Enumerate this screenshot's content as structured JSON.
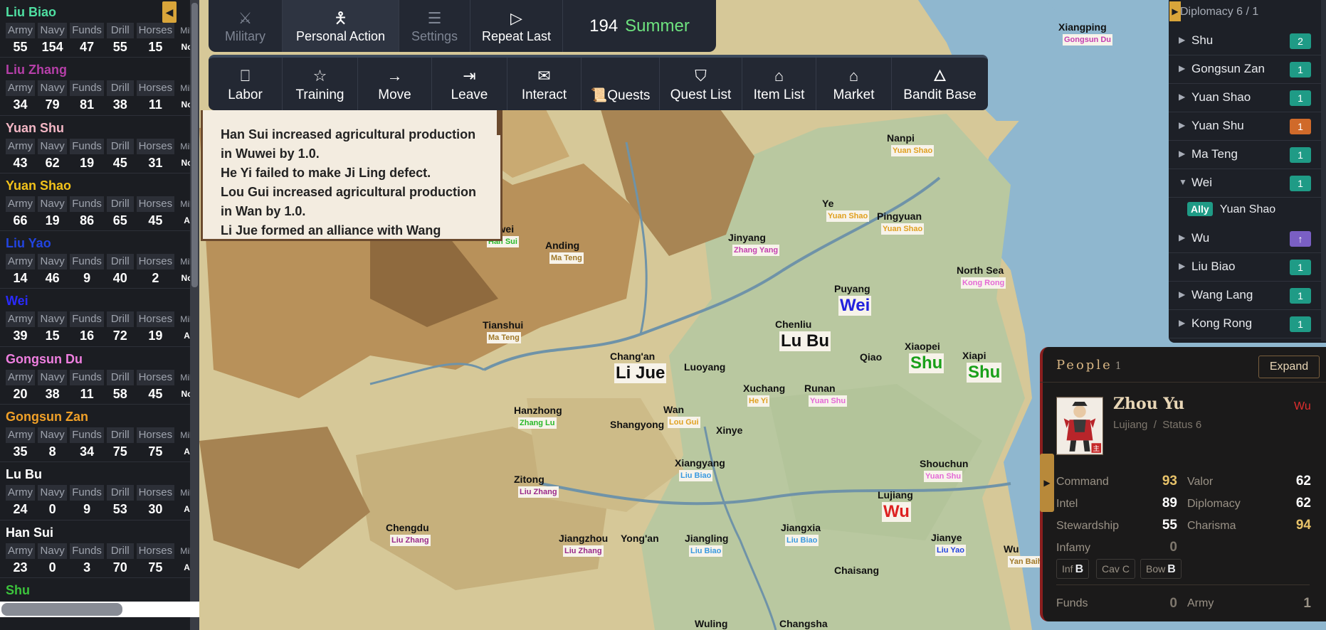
{
  "top_tabs": [
    {
      "label": "Military",
      "icon": "swords-icon"
    },
    {
      "label": "Personal Action",
      "icon": "person-icon"
    },
    {
      "label": "Settings",
      "icon": "sliders-icon"
    },
    {
      "label": "Repeat Last",
      "icon": "play-icon"
    }
  ],
  "date": {
    "year": "194",
    "season": "Summer"
  },
  "actions": [
    {
      "label": "Labor",
      "icon": "briefcase-icon"
    },
    {
      "label": "Training",
      "icon": "star-icon"
    },
    {
      "label": "Move",
      "icon": "arrow-right-icon"
    },
    {
      "label": "Leave",
      "icon": "exit-icon"
    },
    {
      "label": "Interact",
      "icon": "chat-icon"
    },
    {
      "label": "Quests",
      "icon": "scroll-icon"
    },
    {
      "label": "Quest List",
      "icon": "bookmark-icon"
    },
    {
      "label": "Item List",
      "icon": "bag-icon"
    },
    {
      "label": "Market",
      "icon": "shop-bag-icon"
    },
    {
      "label": "Bandit Base",
      "icon": "flame-icon"
    }
  ],
  "log": [
    "Han Sui increased agricultural production",
    "in Wuwei by 1.0.",
    "He Yi failed to make Ji Ling defect.",
    "Lou Gui increased agricultural production",
    "in Wan by 1.0.",
    "Li Jue formed an alliance with Wang"
  ],
  "stat_labels": {
    "army": "Army",
    "navy": "Navy",
    "funds": "Funds",
    "drill": "Drill",
    "horses": "Horses",
    "mil": "Mil."
  },
  "factions": [
    {
      "name": "Liu Biao",
      "color": "#4fe0a2",
      "army": "55",
      "navy": "154",
      "funds": "47",
      "drill": "55",
      "horses": "15",
      "mil": "No"
    },
    {
      "name": "Liu Zhang",
      "color": "#b53fa8",
      "army": "34",
      "navy": "79",
      "funds": "81",
      "drill": "38",
      "horses": "11",
      "mil": "No"
    },
    {
      "name": "Yuan Shu",
      "color": "#f4b7c5",
      "army": "43",
      "navy": "62",
      "funds": "19",
      "drill": "45",
      "horses": "31",
      "mil": "No"
    },
    {
      "name": "Yuan Shao",
      "color": "#f2c21a",
      "army": "66",
      "navy": "19",
      "funds": "86",
      "drill": "65",
      "horses": "45",
      "mil": "A"
    },
    {
      "name": "Liu Yao",
      "color": "#2244e0",
      "army": "14",
      "navy": "46",
      "funds": "9",
      "drill": "40",
      "horses": "2",
      "mil": "No"
    },
    {
      "name": "Wei",
      "color": "#2a2aff",
      "army": "39",
      "navy": "15",
      "funds": "16",
      "drill": "72",
      "horses": "19",
      "mil": "A"
    },
    {
      "name": "Gongsun Du",
      "color": "#ef7fe0",
      "army": "20",
      "navy": "38",
      "funds": "11",
      "drill": "58",
      "horses": "45",
      "mil": "No"
    },
    {
      "name": "Gongsun Zan",
      "color": "#f0a028",
      "army": "35",
      "navy": "8",
      "funds": "34",
      "drill": "75",
      "horses": "75",
      "mil": "A"
    },
    {
      "name": "Lu Bu",
      "color": "#ffffff",
      "army": "24",
      "navy": "0",
      "funds": "9",
      "drill": "53",
      "horses": "30",
      "mil": "A"
    },
    {
      "name": "Han Sui",
      "color": "#ffffff",
      "army": "23",
      "navy": "0",
      "funds": "3",
      "drill": "70",
      "horses": "75",
      "mil": "A"
    },
    {
      "name": "Shu",
      "color": "#3cc43c",
      "army": "",
      "navy": "",
      "funds": "",
      "drill": "",
      "horses": "",
      "mil": ""
    }
  ],
  "diplomacy": {
    "title": "Diplomacy 6 / 1",
    "rows": [
      {
        "name": "Shu",
        "badge": "2",
        "badge_color": "#1f9b86",
        "expanded": false
      },
      {
        "name": "Gongsun Zan",
        "badge": "1",
        "badge_color": "#1f9b86",
        "expanded": false
      },
      {
        "name": "Yuan Shao",
        "badge": "1",
        "badge_color": "#1f9b86",
        "expanded": false
      },
      {
        "name": "Yuan Shu",
        "badge": "1",
        "badge_color": "#d06a2a",
        "expanded": false
      },
      {
        "name": "Ma Teng",
        "badge": "1",
        "badge_color": "#1f9b86",
        "expanded": false
      },
      {
        "name": "Wei",
        "badge": "1",
        "badge_color": "#1f9b86",
        "expanded": true
      },
      {
        "name": "Wu",
        "badge": "↑",
        "badge_color": "#7a5fc4",
        "expanded": false
      },
      {
        "name": "Liu Biao",
        "badge": "1",
        "badge_color": "#1f9b86",
        "expanded": false
      },
      {
        "name": "Wang Lang",
        "badge": "1",
        "badge_color": "#1f9b86",
        "expanded": false
      },
      {
        "name": "Kong Rong",
        "badge": "1",
        "badge_color": "#1f9b86",
        "expanded": false
      }
    ],
    "ally": {
      "badge": "Ally",
      "name": "Yuan Shao"
    }
  },
  "people": {
    "title": "People",
    "count": "1",
    "expand_label": "Expand",
    "name": "Zhou Yu",
    "faction": "Wu",
    "location": "Lujiang",
    "status": "Status 6",
    "stats": [
      {
        "label": "Command",
        "value": "93",
        "color": "#e8c36a"
      },
      {
        "label": "Valor",
        "value": "62",
        "color": "#ffffff"
      },
      {
        "label": "Intel",
        "value": "89",
        "color": "#ffffff"
      },
      {
        "label": "Diplomacy",
        "value": "62",
        "color": "#ffffff"
      },
      {
        "label": "Stewardship",
        "value": "55",
        "color": "#ffffff"
      },
      {
        "label": "Charisma",
        "value": "94",
        "color": "#e8c36a"
      },
      {
        "label": "Infamy",
        "value": "0",
        "color": "#7e776d"
      }
    ],
    "units": [
      {
        "label": "Inf",
        "grade": "B"
      },
      {
        "label": "Cav",
        "grade": "C"
      },
      {
        "label": "Bow",
        "grade": "B"
      }
    ],
    "funds_label": "Funds",
    "funds_value": "0",
    "army_label": "Army",
    "army_value": "1"
  },
  "map": {
    "cities": [
      {
        "name": "Xiangping",
        "owner": "Gongsun Du",
        "color": "#c43fb0"
      },
      {
        "name": "Nanpi",
        "owner": "Yuan Shao",
        "color": "#e0a020"
      },
      {
        "name": "Ye",
        "owner": "Yuan Shao",
        "color": "#e0a020"
      },
      {
        "name": "Pingyuan",
        "owner": "Yuan Shao",
        "color": "#e0a020"
      },
      {
        "name": "North Sea",
        "owner": "Kong Rong",
        "color": "#e46ad6"
      },
      {
        "name": "Jinyang",
        "owner": "Zhang Yang",
        "color": "#c43fb0"
      },
      {
        "name": "Puyang",
        "owner": "Wei",
        "color": "#2222dd"
      },
      {
        "name": "Wuwei",
        "owner": "Han Sui",
        "color": "#28b828"
      },
      {
        "name": "Anding",
        "owner": "Ma Teng",
        "color": "#a07828"
      },
      {
        "name": "Tianshui",
        "owner": "Ma Teng",
        "color": "#a07828"
      },
      {
        "name": "Chenliu",
        "owner": "Lu Bu",
        "color": "#111111"
      },
      {
        "name": "Xiaopei",
        "owner": "Shu",
        "color": "#1aa01a"
      },
      {
        "name": "Xiapi",
        "owner": "Shu",
        "color": "#1aa01a"
      },
      {
        "name": "Qiao",
        "owner": "",
        "color": ""
      },
      {
        "name": "Chang'an",
        "owner": "Li Jue",
        "color": "#111111"
      },
      {
        "name": "Luoyang",
        "owner": "",
        "color": ""
      },
      {
        "name": "Xuchang",
        "owner": "He Yi",
        "color": "#e0a020"
      },
      {
        "name": "Runan",
        "owner": "Yuan Shu",
        "color": "#e46ad6"
      },
      {
        "name": "Hanzhong",
        "owner": "Zhang Lu",
        "color": "#28b828"
      },
      {
        "name": "Wan",
        "owner": "Lou Gui",
        "color": "#e0a020"
      },
      {
        "name": "Shangyong",
        "owner": "",
        "color": ""
      },
      {
        "name": "Xinye",
        "owner": "",
        "color": ""
      },
      {
        "name": "Zitong",
        "owner": "Liu Zhang",
        "color": "#9a2a8a"
      },
      {
        "name": "Xiangyang",
        "owner": "Liu Biao",
        "color": "#3a9ae0"
      },
      {
        "name": "Shouchun",
        "owner": "Yuan Shu",
        "color": "#e46ad6"
      },
      {
        "name": "Lujiang",
        "owner": "Wu",
        "color": "#dd2222"
      },
      {
        "name": "Chengdu",
        "owner": "Liu Zhang",
        "color": "#9a2a8a"
      },
      {
        "name": "Jiangzhou",
        "owner": "Liu Zhang",
        "color": "#9a2a8a"
      },
      {
        "name": "Yong'an",
        "owner": "",
        "color": ""
      },
      {
        "name": "Jiangling",
        "owner": "Liu Biao",
        "color": "#3a9ae0"
      },
      {
        "name": "Jiangxia",
        "owner": "Liu Biao",
        "color": "#3a9ae0"
      },
      {
        "name": "Jianye",
        "owner": "Liu Yao",
        "color": "#2244e0"
      },
      {
        "name": "Wu",
        "owner": "Yan Baihu",
        "color": "#a07828"
      },
      {
        "name": "Chaisang",
        "owner": "",
        "color": ""
      },
      {
        "name": "Wuling",
        "owner": "",
        "color": ""
      },
      {
        "name": "Changsha",
        "owner": "",
        "color": ""
      }
    ]
  }
}
